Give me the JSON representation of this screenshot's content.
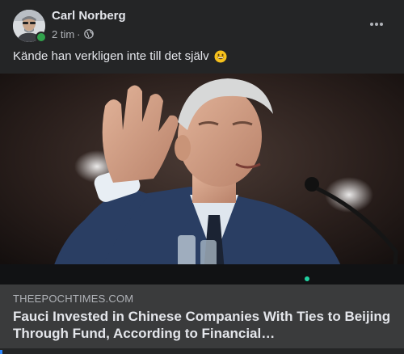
{
  "post": {
    "author": "Carl Norberg",
    "time": "2 tim",
    "separator": "·",
    "privacy_icon": "globe-icon",
    "more_icon": "more-options-icon",
    "text": "Kände han verkligen inte till det själv",
    "emoji": "grinning-face-emoji"
  },
  "link": {
    "domain": "THEEPOCHTIMES.COM",
    "headline": "Fauci Invested in Chinese Companies With Ties to Beijing Through Fund, According to Financial…"
  },
  "colors": {
    "card_bg": "#242526",
    "link_info_bg": "#3a3b3c",
    "primary_text": "#e4e6eb",
    "secondary_text": "#b0b3b8",
    "online": "#31a24c"
  }
}
